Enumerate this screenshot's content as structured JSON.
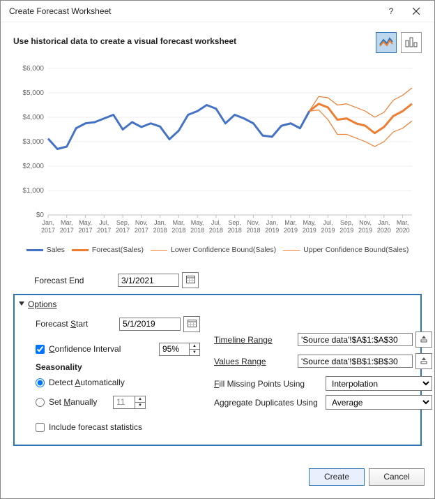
{
  "dialog": {
    "title": "Create Forecast Worksheet",
    "instruction": "Use historical data to create a visual forecast worksheet"
  },
  "chart_type": {
    "line_selected": true
  },
  "forecast_end": {
    "label": "Forecast End",
    "value": "3/1/2021"
  },
  "options": {
    "header": "Options",
    "forecast_start": {
      "label": "Forecast Start",
      "value": "5/1/2019"
    },
    "confidence": {
      "label": "Confidence Interval",
      "value": "95%",
      "checked": true
    },
    "seasonality": {
      "label": "Seasonality",
      "detect": {
        "label": "Detect Automatically",
        "checked": true
      },
      "manual": {
        "label": "Set Manually",
        "value": "11",
        "checked": false
      }
    },
    "include_stats": {
      "label": "Include forecast statistics",
      "checked": false
    },
    "timeline_range": {
      "label": "Timeline Range",
      "value": "'Source data'!$A$1:$A$30"
    },
    "values_range": {
      "label": "Values Range",
      "value": "'Source data'!$B$1:$B$30"
    },
    "fill_missing": {
      "label": "Fill Missing Points Using",
      "value": "Interpolation"
    },
    "aggregate": {
      "label": "Aggregate Duplicates Using",
      "value": "Average"
    }
  },
  "buttons": {
    "create": "Create",
    "cancel": "Cancel"
  },
  "legend": {
    "sales": "Sales",
    "forecast": "Forecast(Sales)",
    "lower": "Lower Confidence Bound(Sales)",
    "upper": "Upper Confidence Bound(Sales)"
  },
  "chart_data": {
    "type": "line",
    "xlabel": "",
    "ylabel": "",
    "ylim": [
      0,
      6000
    ],
    "yticks": [
      0,
      1000,
      2000,
      3000,
      4000,
      5000,
      6000
    ],
    "yticklabels": [
      "$0",
      "$1,000",
      "$2,000",
      "$3,000",
      "$4,000",
      "$5,000",
      "$6,000"
    ],
    "x_categories": [
      "Jan, 2017",
      "Mar, 2017",
      "May, 2017",
      "Jul, 2017",
      "Sep, 2017",
      "Nov, 2017",
      "Jan, 2018",
      "Mar, 2018",
      "May, 2018",
      "Jul, 2018",
      "Sep, 2018",
      "Nov, 2018",
      "Jan, 2019",
      "Mar, 2019",
      "May, 2019",
      "Jul, 2019",
      "Sep, 2019",
      "Nov, 2019",
      "Jan, 2020",
      "Mar, 2020"
    ],
    "x_count": 40,
    "series": [
      {
        "name": "Sales",
        "color": "#4472C4",
        "thick": true,
        "from": 0,
        "to": 28,
        "values": [
          3125,
          2700,
          2800,
          3550,
          3750,
          3800,
          3950,
          4100,
          3500,
          3800,
          3600,
          3750,
          3620,
          3100,
          3450,
          4100,
          4250,
          4500,
          4350,
          3750,
          4100,
          3950,
          3750,
          3250,
          3200,
          3650,
          3750,
          3550,
          4250
        ]
      },
      {
        "name": "Forecast(Sales)",
        "color": "#ED7D31",
        "thick": true,
        "from": 28,
        "to": 39,
        "values": [
          4250,
          4550,
          4400,
          3900,
          3950,
          3750,
          3650,
          3350,
          3600,
          4050,
          4250,
          4550
        ]
      },
      {
        "name": "Lower Confidence Bound(Sales)",
        "color": "#ED7D31",
        "thick": false,
        "from": 28,
        "to": 39,
        "values": [
          4250,
          4300,
          3900,
          3300,
          3300,
          3150,
          3000,
          2800,
          3000,
          3400,
          3550,
          3850
        ]
      },
      {
        "name": "Upper Confidence Bound(Sales)",
        "color": "#ED7D31",
        "thick": false,
        "from": 28,
        "to": 39,
        "values": [
          4250,
          4850,
          4800,
          4500,
          4550,
          4400,
          4250,
          4000,
          4200,
          4700,
          4900,
          5200
        ]
      }
    ]
  }
}
